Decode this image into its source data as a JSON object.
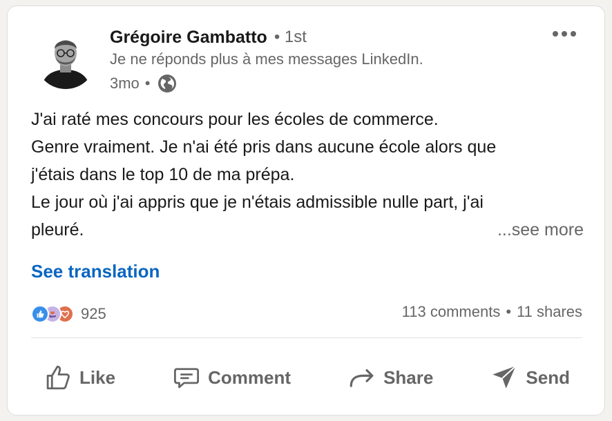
{
  "post": {
    "author_name": "Grégoire Gambatto",
    "degree": "• 1st",
    "headline": "Je ne réponds plus à mes messages LinkedIn.",
    "time": "3mo",
    "time_separator": "•",
    "visibility_icon": "globe-icon",
    "more_icon": "more-options-icon",
    "body_lines": [
      "J'ai raté mes concours pour les écoles de commerce.",
      "Genre vraiment. Je n'ai été pris dans aucune école alors que",
      "j'étais dans le top 10 de ma prépa.",
      "Le jour où j'ai appris que je n'étais admissible nulle part, j'ai",
      "pleuré."
    ],
    "see_more": "...see more",
    "see_translation": "See translation"
  },
  "social": {
    "reaction_icons": [
      "like-reaction-icon",
      "support-reaction-icon",
      "love-reaction-icon"
    ],
    "reactions_count": "925",
    "comments": "113 comments",
    "separator": "•",
    "shares": "11 shares"
  },
  "actions": {
    "like": "Like",
    "comment": "Comment",
    "share": "Share",
    "send": "Send"
  },
  "colors": {
    "link_blue": "#0a66c2",
    "muted_text": "#666666",
    "like_blue": "#378fe9",
    "love_red": "#df704d",
    "support_purple": "#c5b3e6"
  }
}
